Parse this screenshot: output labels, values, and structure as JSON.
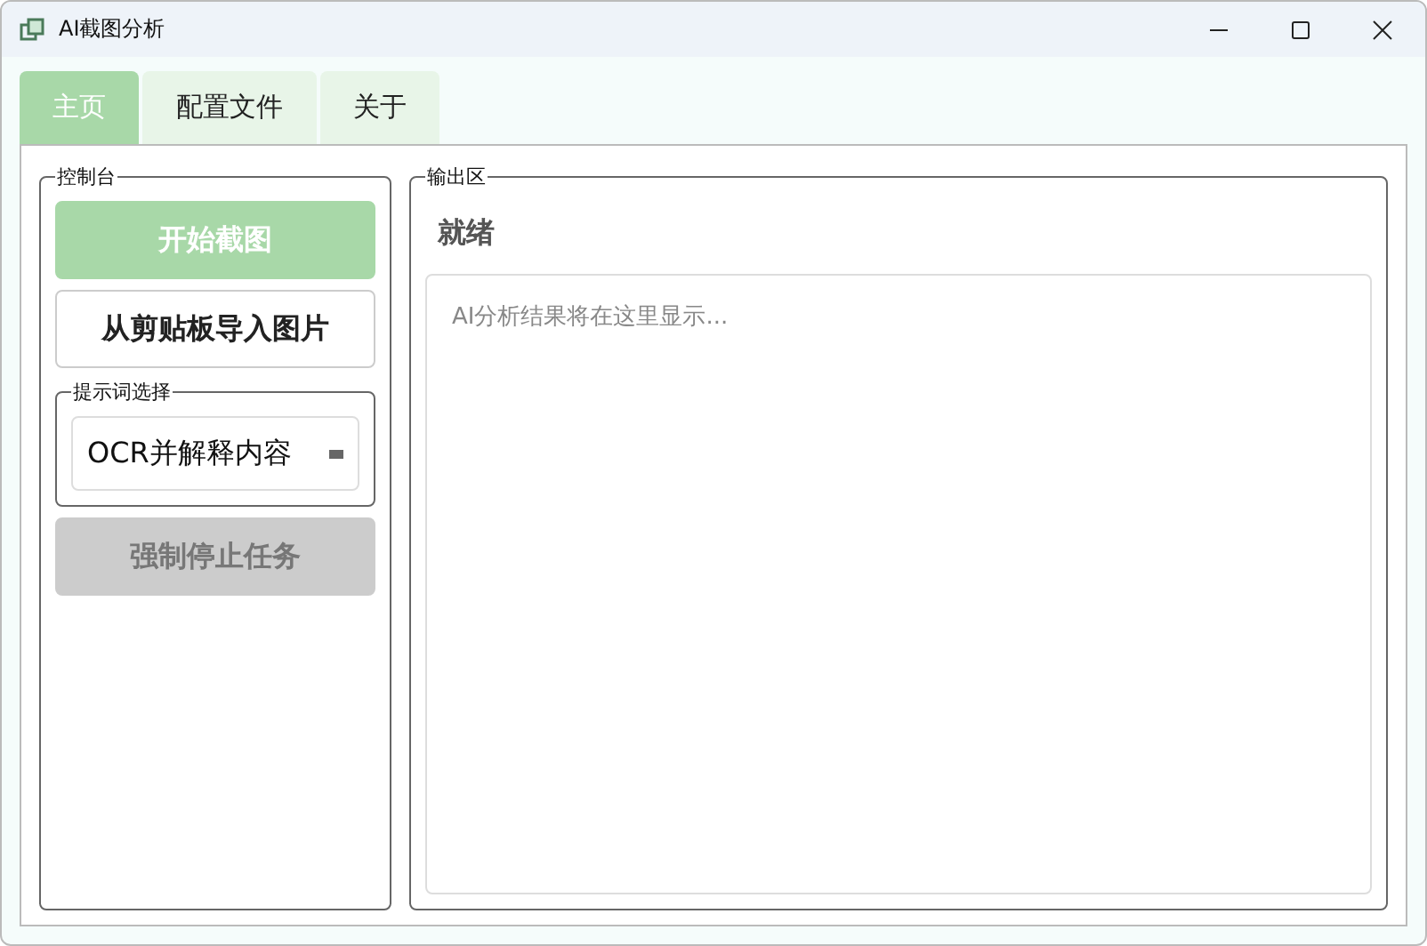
{
  "window": {
    "title": "AI截图分析"
  },
  "tabs": [
    {
      "label": "主页",
      "selected": true
    },
    {
      "label": "配置文件",
      "selected": false
    },
    {
      "label": "关于",
      "selected": false
    }
  ],
  "control_panel": {
    "title": "控制台",
    "buttons": [
      {
        "label": "开始截图",
        "kind": "primary",
        "disabled": false
      },
      {
        "label": "从剪贴板导入图片",
        "kind": "secondary",
        "disabled": false
      }
    ],
    "prompt_group": {
      "title": "提示词选择",
      "value": "OCR并解释内容"
    },
    "stop_button": {
      "label": "强制停止任务",
      "disabled": true
    }
  },
  "output_panel": {
    "title": "输出区",
    "status": "就绪",
    "placeholder": "AI分析结果将在这里显示..."
  }
}
